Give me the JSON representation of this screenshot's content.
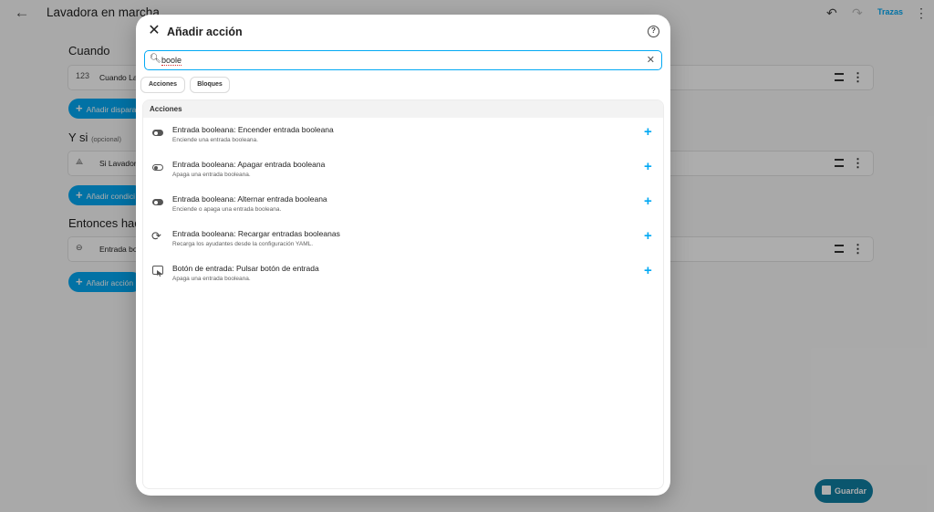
{
  "header": {
    "title": "Lavadora en marcha",
    "traces_label": "Trazas"
  },
  "sections": {
    "when": {
      "title": "Cuando",
      "card_icon": "123",
      "card_text": "Cuando Lav",
      "add_label": "Añadir dispara"
    },
    "and_if": {
      "title": "Y si",
      "optional": "(opcional)",
      "card_text": "Si Lavadora",
      "add_label": "Añadir condici"
    },
    "then": {
      "title": "Entonces hace",
      "card_text": "Entrada boo",
      "add_label": "Añadir acción"
    }
  },
  "save_label": "Guardar",
  "dialog": {
    "title": "Añadir acción",
    "search": {
      "value": "boole"
    },
    "chips": [
      "Acciones",
      "Bloques"
    ],
    "list_header": "Acciones",
    "items": [
      {
        "icon": "toggle-on-icon",
        "title": "Entrada booleana: Encender entrada booleana",
        "desc": "Enciende una entrada booleana."
      },
      {
        "icon": "toggle-off-icon",
        "title": "Entrada booleana: Apagar entrada booleana",
        "desc": "Apaga una entrada booleana."
      },
      {
        "icon": "toggle-on-icon",
        "title": "Entrada booleana: Alternar entrada booleana",
        "desc": "Enciende o apaga una entrada booleana."
      },
      {
        "icon": "reload-icon",
        "title": "Entrada booleana: Recargar entradas booleanas",
        "desc": "Recarga los ayudantes desde la configuración YAML."
      },
      {
        "icon": "button-press-icon",
        "title": "Botón de entrada: Pulsar botón de entrada",
        "desc": "Apaga una entrada booleana."
      }
    ]
  },
  "colors": {
    "accent": "#03a9f4",
    "save": "#0f7fa3"
  }
}
